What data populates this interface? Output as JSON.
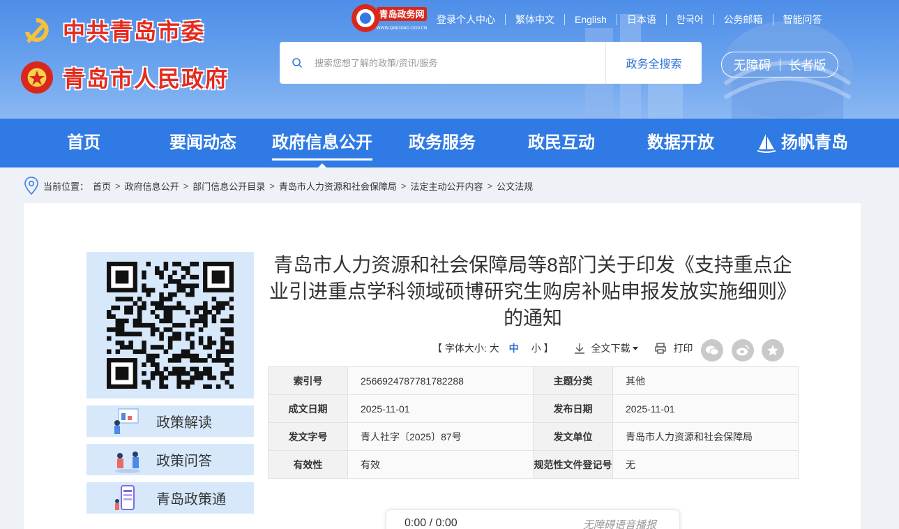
{
  "header": {
    "party_logo_text": "中共青岛市委",
    "gov_logo_text": "青岛市人民政府",
    "site_badge": {
      "title": "青岛政务网",
      "url_text": "WWW.QINGDAO.GOV.CN"
    },
    "top_links": [
      "登录个人中心",
      "繁体中文",
      "English",
      "日本语",
      "한국어",
      "公务邮箱",
      "智能问答"
    ],
    "search": {
      "placeholder": "搜索您想了解的政策/资讯/服务",
      "button": "政务全搜索"
    },
    "access": {
      "barrier_free": "无障碍",
      "elder": "长者版"
    }
  },
  "nav": {
    "items": [
      "首页",
      "要闻动态",
      "政府信息公开",
      "政务服务",
      "政民互动",
      "数据开放",
      "扬帆青岛"
    ],
    "active": "政府信息公开"
  },
  "breadcrumb": {
    "label": "当前位置：",
    "items": [
      "首页",
      "政府信息公开",
      "部门信息公开目录",
      "青岛市人力资源和社会保障局",
      "法定主动公开内容",
      "公文法规"
    ]
  },
  "sidebar": {
    "buttons": [
      "政策解读",
      "政策问答",
      "青岛政策通"
    ]
  },
  "article": {
    "title": "青岛市人力资源和社会保障局等8部门关于印发《支持重点企业引进重点学科领域硕博研究生购房补贴申报发放实施细则》的通知",
    "font_label": "【 字体大小: 大",
    "font_mid": "中",
    "font_small": "小 】",
    "download": "全文下载",
    "print": "打印",
    "share_icons": [
      "wechat-icon",
      "weibo-icon",
      "favorite-icon"
    ]
  },
  "meta": {
    "rows": [
      [
        {
          "k": "索引号",
          "v": "2566924787781782288"
        },
        {
          "k": "主题分类",
          "v": "其他"
        }
      ],
      [
        {
          "k": "成文日期",
          "v": "2025-11-01"
        },
        {
          "k": "发布日期",
          "v": "2025-11-01"
        }
      ],
      [
        {
          "k": "发文字号",
          "v": "青人社字〔2025〕87号"
        },
        {
          "k": "发文单位",
          "v": "青岛市人力资源和社会保障局"
        }
      ],
      [
        {
          "k": "有效性",
          "v": "有效"
        },
        {
          "k": "规范性文件登记号",
          "v": "无"
        }
      ]
    ]
  },
  "audio": {
    "time": "0:00 / 0:00",
    "tts_label": "无障碍语音播报"
  },
  "colors": {
    "primary": "#2f7ae4",
    "header_top": "#4e8ee8",
    "logo_red": "#e52a1f",
    "side_bg": "#d7e8fb",
    "link_blue": "#2f6fd8"
  }
}
